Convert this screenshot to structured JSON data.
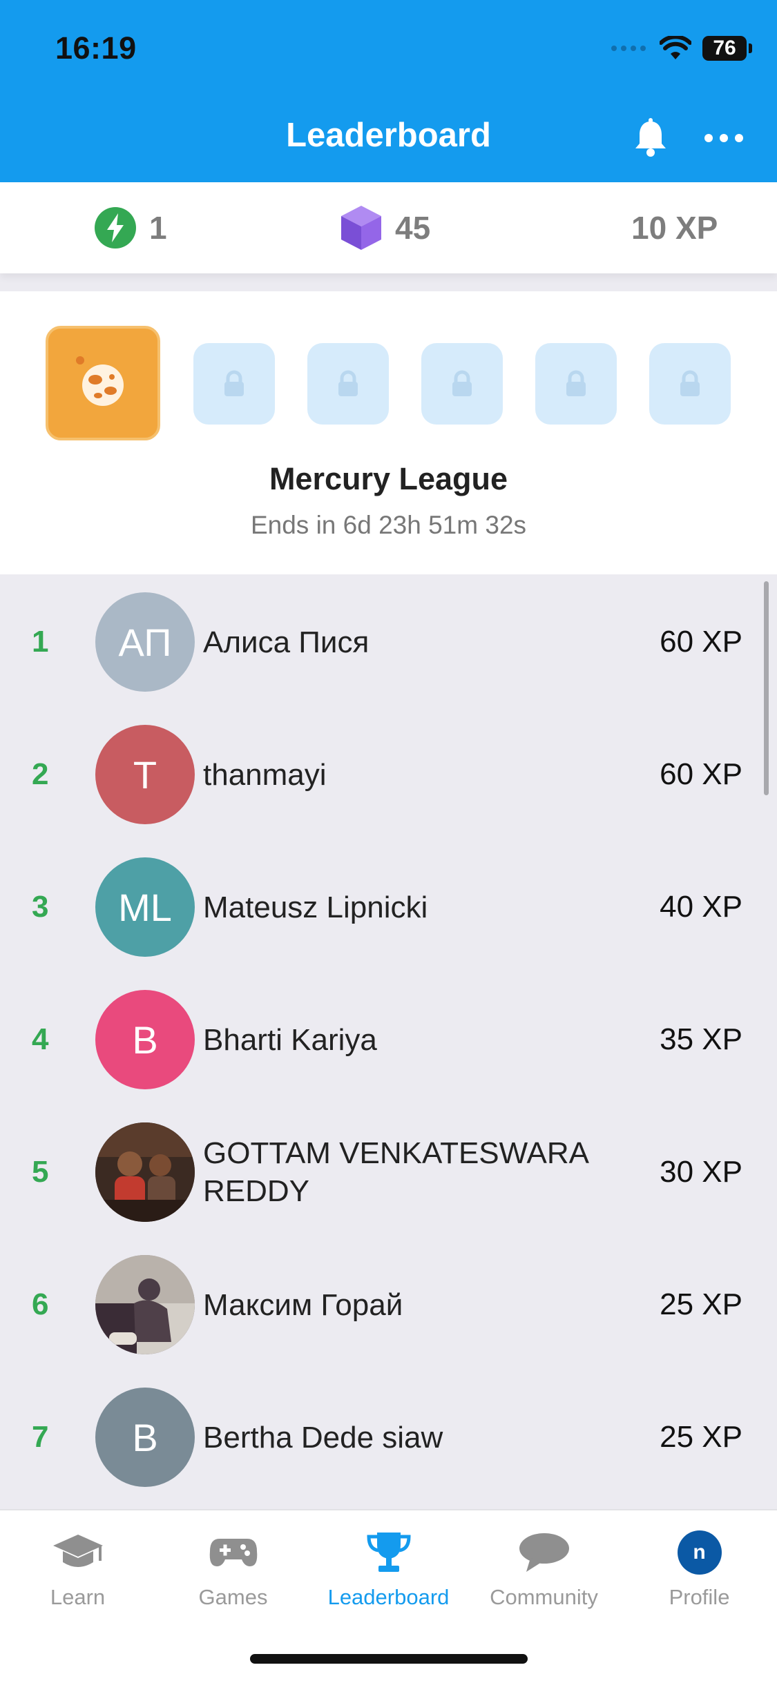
{
  "status_bar": {
    "time": "16:19",
    "battery": "76"
  },
  "header": {
    "title": "Leaderboard"
  },
  "stats": {
    "streak": "1",
    "gems": "45",
    "xp": "10 XP"
  },
  "league": {
    "name": "Mercury League",
    "ends_in": "Ends in 6d 23h 51m 32s",
    "locked_count": 5
  },
  "leaderboard": [
    {
      "rank": "1",
      "initials": "АП",
      "name": "Алиса Пися",
      "xp": "60 XP",
      "color": "#aab8c6"
    },
    {
      "rank": "2",
      "initials": "T",
      "name": "thanmayi",
      "xp": "60 XP",
      "color": "#c85c61"
    },
    {
      "rank": "3",
      "initials": "ML",
      "name": "Mateusz Lipnicki",
      "xp": "40 XP",
      "color": "#4ea0a6"
    },
    {
      "rank": "4",
      "initials": "B",
      "name": "Bharti Kariya",
      "xp": "35 XP",
      "color": "#e94a7d"
    },
    {
      "rank": "5",
      "initials": "",
      "name": "GOTTAM VENKATESWARA REDDY",
      "xp": "30 XP",
      "color": "#3a2a24",
      "photo": true
    },
    {
      "rank": "6",
      "initials": "",
      "name": "Максим Горай",
      "xp": "25 XP",
      "color": "#5a4e55",
      "photo": true
    },
    {
      "rank": "7",
      "initials": "B",
      "name": "Bertha Dede siaw",
      "xp": "25 XP",
      "color": "#7a8b96"
    }
  ],
  "tabbar": {
    "learn": "Learn",
    "games": "Games",
    "leaderboard": "Leaderboard",
    "community": "Community",
    "profile": "Profile",
    "profile_initial": "n"
  },
  "colors": {
    "brand": "#149bee",
    "rank_green": "#34a853",
    "league_orange": "#f2a63d",
    "locked_blue": "#d6ebfb"
  }
}
